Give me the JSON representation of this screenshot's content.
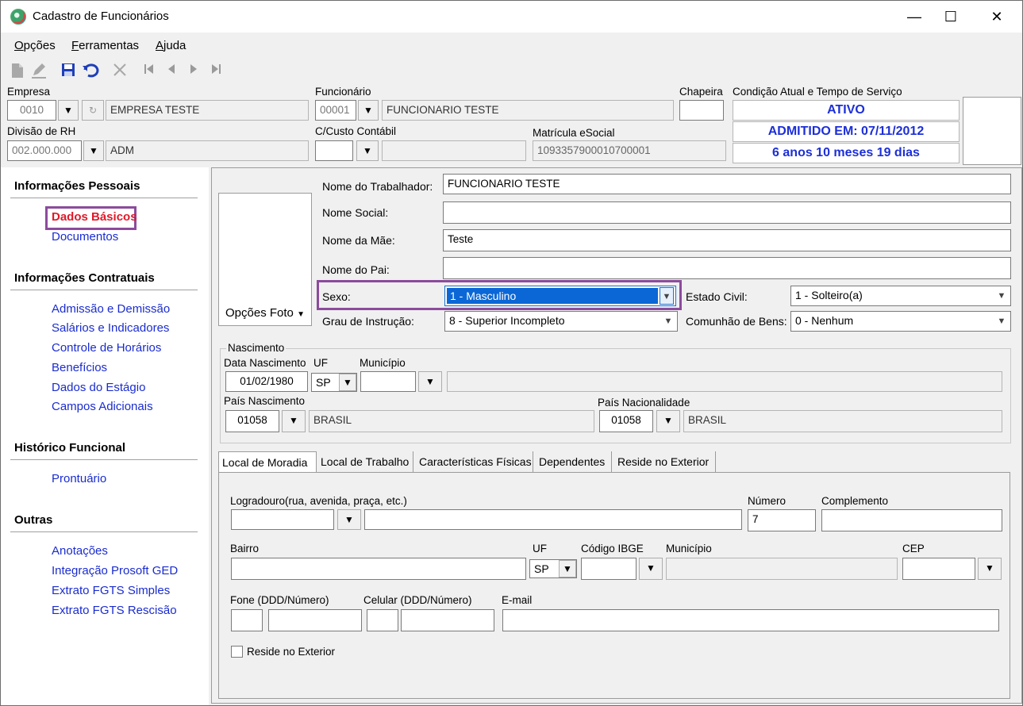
{
  "window": {
    "title": "Cadastro de Funcionários",
    "controls": {
      "minimize": "—",
      "maximize": "☐",
      "close": "✕"
    }
  },
  "menu": [
    "Opções",
    "Ferramentas",
    "Ajuda"
  ],
  "toolbar_icons": [
    "new-document-icon",
    "edit-icon",
    "save-icon",
    "undo-icon",
    "delete-icon",
    "first-record-icon",
    "previous-record-icon",
    "next-record-icon",
    "last-record-icon"
  ],
  "header": {
    "empresa": {
      "label": "Empresa",
      "code": "0010",
      "name": "EMPRESA TESTE"
    },
    "funcionario": {
      "label": "Funcionário",
      "code": "00001",
      "name": "FUNCIONARIO TESTE"
    },
    "chapeira": {
      "label": "Chapeira",
      "value": ""
    },
    "condicao": {
      "label": "Condição Atual e Tempo de Serviço",
      "status": "ATIVO",
      "admitido": "ADMITIDO EM: 07/11/2012",
      "tempo": "6 anos 10 meses 19 dias"
    },
    "divisao": {
      "label": "Divisão de RH",
      "code": "002.000.000",
      "name": "ADM"
    },
    "custo": {
      "label": "C/Custo Contábil",
      "code": "",
      "name": ""
    },
    "matricula": {
      "label": "Matrícula eSocial",
      "value": "1093357900010700001"
    }
  },
  "sidebar": {
    "sections": [
      {
        "title": "Informações Pessoais",
        "items": [
          "Dados Básicos",
          "Documentos"
        ]
      },
      {
        "title": "Informações Contratuais",
        "items": [
          "Admissão e Demissão",
          "Salários e Indicadores",
          "Controle de Horários",
          "Benefícios",
          "Dados do Estágio",
          "Campos Adicionais"
        ]
      },
      {
        "title": "Histórico Funcional",
        "items": [
          "Prontuário"
        ]
      },
      {
        "title": "Outras",
        "items": [
          "Anotações",
          "Integração Prosoft GED",
          "Extrato FGTS Simples",
          "Extrato FGTS Rescisão"
        ]
      }
    ],
    "active_item": "Dados Básicos"
  },
  "personal": {
    "photo_button": "Opções Foto",
    "nome_trabalhador": {
      "label": "Nome do Trabalhador:",
      "value": "FUNCIONARIO TESTE"
    },
    "nome_social": {
      "label": "Nome Social:",
      "value": ""
    },
    "nome_mae": {
      "label": "Nome da Mãe:",
      "value": "Teste"
    },
    "nome_pai": {
      "label": "Nome do Pai:",
      "value": ""
    },
    "sexo": {
      "label": "Sexo:",
      "value": "1 - Masculino"
    },
    "estado_civil": {
      "label": "Estado Civil:",
      "value": "1 - Solteiro(a)"
    },
    "grau_instrucao": {
      "label": "Grau de Instrução:",
      "value": "8 - Superior Incompleto"
    },
    "comunhao_bens": {
      "label": "Comunhão de Bens:",
      "value": "0 - Nenhum"
    }
  },
  "nascimento": {
    "group_label": "Nascimento",
    "data": {
      "label": "Data Nascimento",
      "value": "01/02/1980"
    },
    "uf": {
      "label": "UF",
      "value": "SP"
    },
    "municipio": {
      "label": "Município",
      "code": "",
      "name": ""
    },
    "pais_nascimento": {
      "label": "País Nascimento",
      "code": "01058",
      "name": "BRASIL"
    },
    "pais_nacionalidade": {
      "label": "País Nacionalidade",
      "code": "01058",
      "name": "BRASIL"
    }
  },
  "tabs": [
    "Local de Moradia",
    "Local de Trabalho",
    "Características Físicas",
    "Dependentes",
    "Reside no Exterior"
  ],
  "moradia": {
    "logradouro": {
      "label": "Logradouro(rua, avenida, praça, etc.)",
      "type": "",
      "value": ""
    },
    "numero": {
      "label": "Número",
      "value": "7"
    },
    "complemento": {
      "label": "Complemento",
      "value": ""
    },
    "bairro": {
      "label": "Bairro",
      "value": ""
    },
    "uf": {
      "label": "UF",
      "value": "SP"
    },
    "codigo_ibge": {
      "label": "Código IBGE",
      "value": ""
    },
    "municipio": {
      "label": "Município",
      "value": ""
    },
    "cep": {
      "label": "CEP",
      "value": ""
    },
    "fone": {
      "label": "Fone (DDD/Número)",
      "ddd": "",
      "numero": ""
    },
    "celular": {
      "label": "Celular (DDD/Número)",
      "ddd": "",
      "numero": ""
    },
    "email": {
      "label": "E-mail",
      "value": ""
    },
    "reside_exterior": {
      "label": "Reside no Exterior",
      "checked": false
    }
  }
}
